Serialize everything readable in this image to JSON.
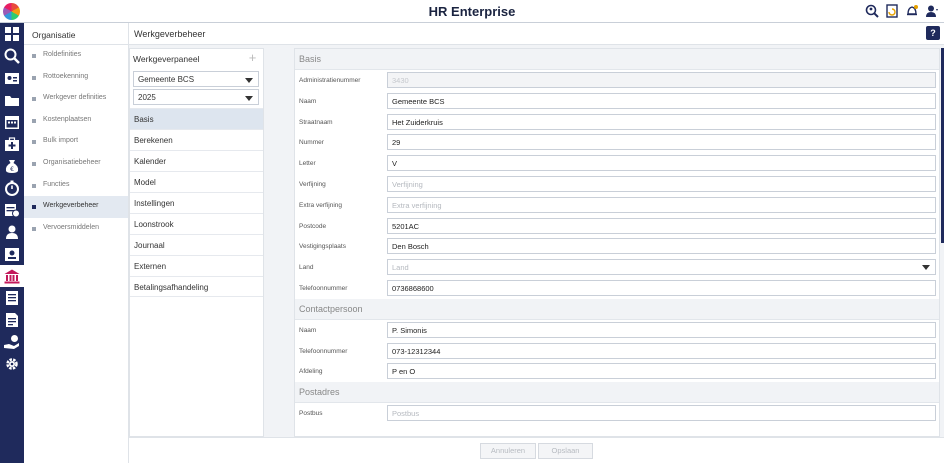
{
  "app": {
    "title": "HR Enterprise"
  },
  "topbar": {
    "icons": [
      "search-people-icon",
      "refresh-document-icon",
      "notification-bell-icon",
      "user-menu-icon"
    ]
  },
  "rail": {
    "icons": [
      "dashboard-grid-icon",
      "search-icon",
      "id-card-icon",
      "folder-icon",
      "calendar-icon",
      "medical-case-icon",
      "money-bag-icon",
      "stopwatch-icon",
      "schedule-icon",
      "person-icon",
      "badge-icon",
      "bank-icon",
      "document-list-icon",
      "report-icon",
      "hand-money-icon",
      "gear-icon"
    ],
    "active_index": 11
  },
  "org": {
    "title": "Organisatie",
    "items": [
      {
        "label": "Roldefinities"
      },
      {
        "label": "Rottoekenning"
      },
      {
        "label": "Werkgever definities"
      },
      {
        "label": "Kostenplaatsen"
      },
      {
        "label": "Bulk import"
      },
      {
        "label": "Organisatiebeheer"
      },
      {
        "label": "Functies"
      },
      {
        "label": "Werkgeverbeheer"
      },
      {
        "label": "Vervoersmiddelen"
      }
    ],
    "active_index": 7
  },
  "main": {
    "title": "Werkgeverbeheer",
    "help_label": "?"
  },
  "panel": {
    "title": "Werkgeverpaneel",
    "plus_label": "+",
    "employer_select": "Gemeente BCS",
    "year_select": "2025",
    "nav": [
      {
        "label": "Basis"
      },
      {
        "label": "Berekenen"
      },
      {
        "label": "Kalender"
      },
      {
        "label": "Model"
      },
      {
        "label": "Instellingen"
      },
      {
        "label": "Loonstrook"
      },
      {
        "label": "Journaal"
      },
      {
        "label": "Externen"
      },
      {
        "label": "Betalingsafhandeling"
      }
    ],
    "active_index": 0
  },
  "form": {
    "basis": {
      "title": "Basis",
      "fields": [
        {
          "label": "Administratienummer",
          "value": "3430",
          "state": "disabled"
        },
        {
          "label": "Naam",
          "value": "Gemeente BCS"
        },
        {
          "label": "Straatnaam",
          "value": "Het Zuiderkruis"
        },
        {
          "label": "Nummer",
          "value": "29"
        },
        {
          "label": "Letter",
          "value": "V"
        },
        {
          "label": "Verfijning",
          "value": "Verfijning",
          "state": "placeholder"
        },
        {
          "label": "Extra verfijning",
          "value": "Extra verfijning",
          "state": "placeholder"
        },
        {
          "label": "Postcode",
          "value": "5201AC"
        },
        {
          "label": "Vestigingsplaats",
          "value": "Den Bosch"
        },
        {
          "label": "Land",
          "value": "Land",
          "state": "placeholder",
          "dropdown": true
        },
        {
          "label": "Telefoonnummer",
          "value": "0736868600"
        }
      ]
    },
    "contact": {
      "title": "Contactpersoon",
      "fields": [
        {
          "label": "Naam",
          "value": "P. Simonis"
        },
        {
          "label": "Telefoonnummer",
          "value": "073-12312344"
        },
        {
          "label": "Afdeling",
          "value": "P en O"
        }
      ]
    },
    "postadres": {
      "title": "Postadres",
      "fields": [
        {
          "label": "Postbus",
          "value": "Postbus",
          "state": "placeholder"
        }
      ]
    }
  },
  "footer": {
    "cancel_label": "Annuleren",
    "save_label": "Opslaan"
  }
}
